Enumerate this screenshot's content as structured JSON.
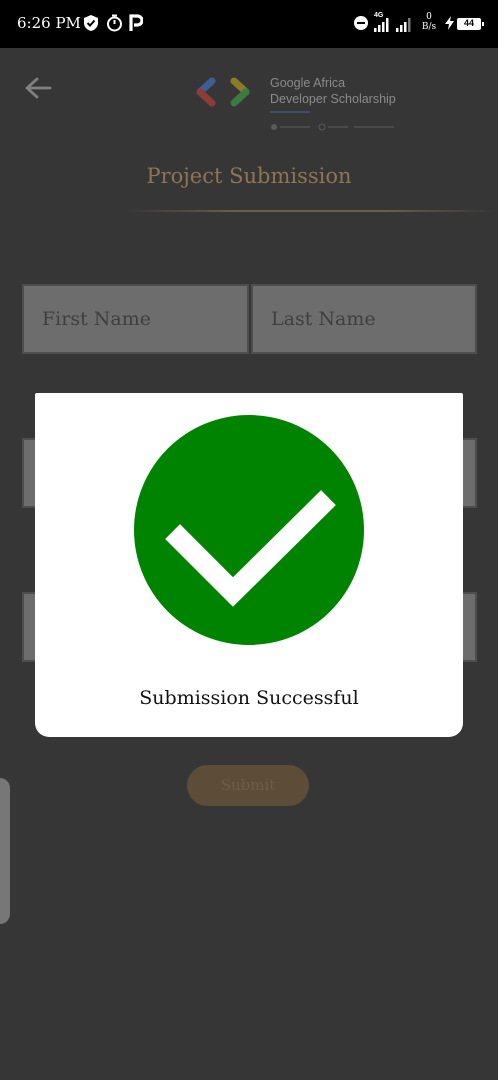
{
  "status_bar": {
    "time": "6:26 PM",
    "net_speed_value": "0",
    "net_speed_unit": "B/s",
    "network_type": "4G",
    "battery": "44",
    "icons": [
      "shield-check-icon",
      "timer-icon",
      "p-app-icon",
      "dnd-icon",
      "signal-icon",
      "signal-icon",
      "charging-icon",
      "battery-icon"
    ]
  },
  "header": {
    "back_icon": "arrow-left-icon",
    "logo_line1": "Google Africa",
    "logo_line2": "Developer Scholarship"
  },
  "page": {
    "title": "Project Submission"
  },
  "form": {
    "first_name_placeholder": "First Name",
    "last_name_placeholder": "Last Name",
    "submit_label": "Submit"
  },
  "dialog": {
    "icon": "check-circle-icon",
    "message": "Submission Successful",
    "colors": {
      "icon_background": "#008400",
      "check": "#ffffff"
    }
  },
  "colors": {
    "background": "#363636",
    "accent": "#8f7650",
    "status_bar": "#000000"
  }
}
